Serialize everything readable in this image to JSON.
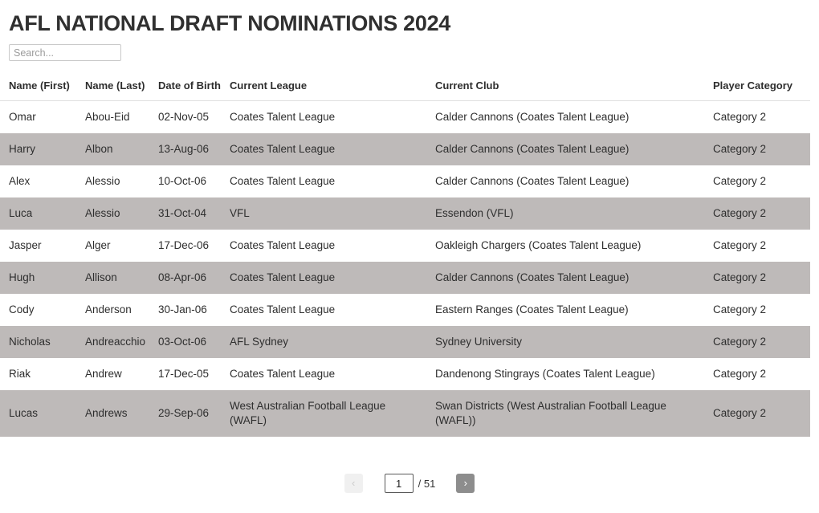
{
  "header": {
    "title": "AFL NATIONAL DRAFT NOMINATIONS 2024"
  },
  "search": {
    "placeholder": "Search...",
    "value": ""
  },
  "table": {
    "columns": [
      "Name (First)",
      "Name (Last)",
      "Date of Birth",
      "Current League",
      "Current Club",
      "Player Category"
    ],
    "rows": [
      {
        "first": "Omar",
        "last": "Abou-Eid",
        "dob": "02-Nov-05",
        "league": "Coates Talent League",
        "club": "Calder Cannons (Coates Talent League)",
        "category": "Category 2"
      },
      {
        "first": "Harry",
        "last": "Albon",
        "dob": "13-Aug-06",
        "league": "Coates Talent League",
        "club": "Calder Cannons (Coates Talent League)",
        "category": "Category 2"
      },
      {
        "first": "Alex",
        "last": "Alessio",
        "dob": "10-Oct-06",
        "league": "Coates Talent League",
        "club": "Calder Cannons (Coates Talent League)",
        "category": "Category 2"
      },
      {
        "first": "Luca",
        "last": "Alessio",
        "dob": "31-Oct-04",
        "league": "VFL",
        "club": "Essendon (VFL)",
        "category": "Category 2"
      },
      {
        "first": "Jasper",
        "last": "Alger",
        "dob": "17-Dec-06",
        "league": "Coates Talent League",
        "club": "Oakleigh Chargers (Coates Talent League)",
        "category": "Category 2"
      },
      {
        "first": "Hugh",
        "last": "Allison",
        "dob": "08-Apr-06",
        "league": "Coates Talent League",
        "club": "Calder Cannons (Coates Talent League)",
        "category": "Category 2"
      },
      {
        "first": "Cody",
        "last": "Anderson",
        "dob": "30-Jan-06",
        "league": "Coates Talent League",
        "club": "Eastern Ranges (Coates Talent League)",
        "category": "Category 2"
      },
      {
        "first": "Nicholas",
        "last": "Andreacchio",
        "dob": "03-Oct-06",
        "league": "AFL Sydney",
        "club": "Sydney University",
        "category": "Category 2"
      },
      {
        "first": "Riak",
        "last": "Andrew",
        "dob": "17-Dec-05",
        "league": "Coates Talent League",
        "club": "Dandenong Stingrays (Coates Talent League)",
        "category": "Category 2"
      },
      {
        "first": "Lucas",
        "last": "Andrews",
        "dob": "29-Sep-06",
        "league": "West Australian Football League (WAFL)",
        "club": "Swan Districts (West Australian Football League (WAFL))",
        "category": "Category 2"
      }
    ]
  },
  "pagination": {
    "prev_label": "‹",
    "next_label": "›",
    "current_page": "1",
    "total_label": "/ 51",
    "total_pages": 51
  },
  "colors": {
    "row_stripe": "#bebab9",
    "row_plain": "#ffffff",
    "title": "#303030",
    "next_button": "#8d8d8d",
    "prev_button": "#f0f0f0"
  }
}
